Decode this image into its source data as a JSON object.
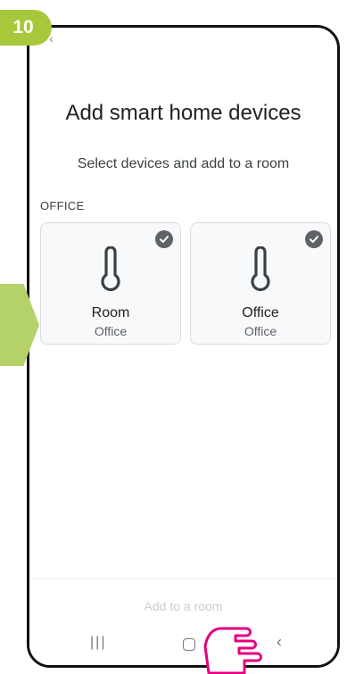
{
  "step": {
    "number": "10"
  },
  "colors": {
    "badge": "#a8c83c",
    "arrow": "#b5d16a",
    "pointer": "#e5007e",
    "check": "#5f6368"
  },
  "header": {
    "back_icon": "chevron-left-icon",
    "back_glyph": "‹"
  },
  "page": {
    "title": "Add smart home devices",
    "subtitle": "Select devices and add to a room"
  },
  "section": {
    "label": "OFFICE"
  },
  "devices": [
    {
      "name": "Room",
      "room": "Office",
      "icon": "thermometer-icon",
      "selected": true
    },
    {
      "name": "Office",
      "room": "Office",
      "icon": "thermometer-icon",
      "selected": true
    }
  ],
  "footer": {
    "button_label": "Add to a room"
  },
  "navbar": {
    "recents_glyph": "|||",
    "back_glyph": "‹"
  }
}
